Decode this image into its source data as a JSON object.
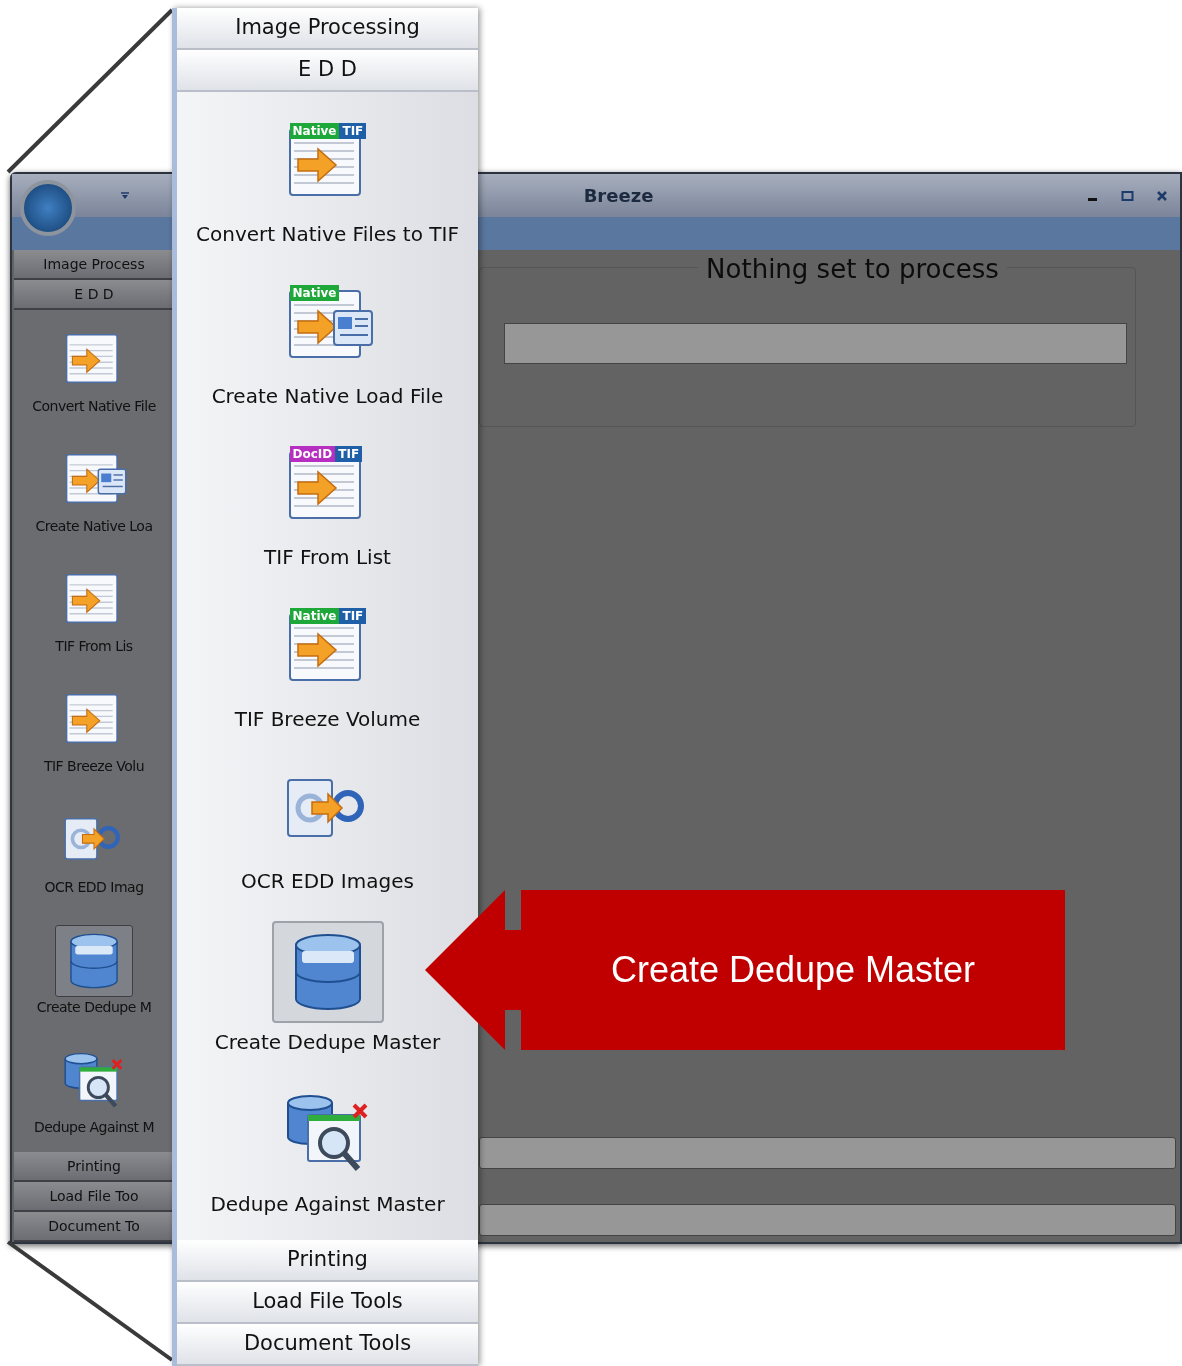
{
  "window": {
    "title": "Breeze"
  },
  "sidebar": {
    "sections_top": [
      "Image Process",
      "E D D"
    ],
    "items": [
      {
        "label": "Convert Native File",
        "kind": "native-tif",
        "selected": false
      },
      {
        "label": "Create Native Loa",
        "kind": "native-load",
        "selected": false
      },
      {
        "label": "TIF From Lis",
        "kind": "docid-tif",
        "selected": false
      },
      {
        "label": "TIF Breeze Volu",
        "kind": "native-tif",
        "selected": false
      },
      {
        "label": "OCR EDD Imag",
        "kind": "ocr",
        "selected": false
      },
      {
        "label": "Create Dedupe M",
        "kind": "dedupe",
        "selected": true
      },
      {
        "label": "Dedupe Against M",
        "kind": "dedupe-against",
        "selected": false
      }
    ],
    "sections_bottom": [
      "Printing",
      "Load File Too",
      "Document To"
    ]
  },
  "panel": {
    "legend": "Nothing set to process"
  },
  "callout": {
    "sections_top": [
      "Image Processing",
      "E D D"
    ],
    "items": [
      {
        "label": "Convert Native Files to TIF",
        "kind": "native-tif",
        "selected": false,
        "badges": [
          {
            "text": "Native",
            "color": "#1fa83a"
          },
          {
            "text": "TIF",
            "color": "#1f5fa8"
          }
        ]
      },
      {
        "label": "Create Native Load File",
        "kind": "native-load",
        "selected": false,
        "badges": [
          {
            "text": "Native",
            "color": "#1fa83a"
          }
        ]
      },
      {
        "label": "TIF From List",
        "kind": "docid-tif",
        "selected": false,
        "badges": [
          {
            "text": "DocID",
            "color": "#b62fc0"
          },
          {
            "text": "TIF",
            "color": "#1f5fa8"
          }
        ]
      },
      {
        "label": "TIF Breeze Volume",
        "kind": "native-tif",
        "selected": false,
        "badges": [
          {
            "text": "Native",
            "color": "#1fa83a"
          },
          {
            "text": "TIF",
            "color": "#1f5fa8"
          }
        ]
      },
      {
        "label": "OCR EDD Images",
        "kind": "ocr",
        "selected": false
      },
      {
        "label": "Create Dedupe Master",
        "kind": "dedupe",
        "selected": true
      },
      {
        "label": "Dedupe Against Master",
        "kind": "dedupe-against",
        "selected": false
      }
    ],
    "sections_bottom": [
      "Printing",
      "Load File Tools",
      "Document Tools"
    ]
  },
  "annotation": {
    "text": "Create Dedupe Master"
  }
}
